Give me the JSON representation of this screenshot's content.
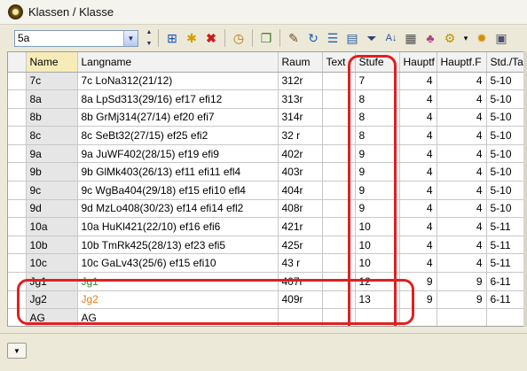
{
  "window": {
    "title": "Klassen / Klasse"
  },
  "toolbar": {
    "combo_value": "5a",
    "icons": [
      "grid-add-icon",
      "new-record-icon",
      "delete-icon",
      "clock-icon",
      "copy-icon",
      "tools-icon",
      "refresh-icon",
      "list-icon",
      "report-icon",
      "filter-icon",
      "sort-icon",
      "fields-icon",
      "users-icon",
      "settings-icon",
      "gear-icon",
      "save-icon"
    ]
  },
  "table": {
    "columns": [
      "Name",
      "Langname",
      "Raum",
      "Text",
      "Stufe",
      "Hauptf",
      "Hauptf.F",
      "Std./Ta"
    ],
    "rows": [
      {
        "name": "7c",
        "langname": "7c LoNa312(21/12)",
        "raum": "312r",
        "text": "",
        "stufe": "7",
        "hauptf": "4",
        "hauptf_f": "4",
        "std": "5-10"
      },
      {
        "name": "8a",
        "langname": "8a LpSd313(29/16) ef17 efi12",
        "raum": "313r",
        "text": "",
        "stufe": "8",
        "hauptf": "4",
        "hauptf_f": "4",
        "std": "5-10"
      },
      {
        "name": "8b",
        "langname": "8b GrMj314(27/14) ef20 efi7",
        "raum": "314r",
        "text": "",
        "stufe": "8",
        "hauptf": "4",
        "hauptf_f": "4",
        "std": "5-10"
      },
      {
        "name": "8c",
        "langname": "8c SeBt32(27/15) ef25 efi2",
        "raum": "32 r",
        "text": "",
        "stufe": "8",
        "hauptf": "4",
        "hauptf_f": "4",
        "std": "5-10"
      },
      {
        "name": "9a",
        "langname": "9a JuWF402(28/15) ef19 efi9",
        "raum": "402r",
        "text": "",
        "stufe": "9",
        "hauptf": "4",
        "hauptf_f": "4",
        "std": "5-10"
      },
      {
        "name": "9b",
        "langname": "9b GlMk403(26/13) ef11 efi11 efl4",
        "raum": "403r",
        "text": "",
        "stufe": "9",
        "hauptf": "4",
        "hauptf_f": "4",
        "std": "5-10"
      },
      {
        "name": "9c",
        "langname": "9c WgBa404(29/18) ef15 efi10 efl4",
        "raum": "404r",
        "text": "",
        "stufe": "9",
        "hauptf": "4",
        "hauptf_f": "4",
        "std": "5-10"
      },
      {
        "name": "9d",
        "langname": "9d MzLo408(30/23) ef14 efi14 efl2",
        "raum": "408r",
        "text": "",
        "stufe": "9",
        "hauptf": "4",
        "hauptf_f": "4",
        "std": "5-10"
      },
      {
        "name": "10a",
        "langname": "10a HuKl421(22/10) ef16 efi6",
        "raum": "421r",
        "text": "",
        "stufe": "10",
        "hauptf": "4",
        "hauptf_f": "4",
        "std": "5-11"
      },
      {
        "name": "10b",
        "langname": "10b TmRk425(28/13) ef23 efi5",
        "raum": "425r",
        "text": "",
        "stufe": "10",
        "hauptf": "4",
        "hauptf_f": "4",
        "std": "5-11"
      },
      {
        "name": "10c",
        "langname": "10c GaLv43(25/6) ef15 efi10",
        "raum": "43 r",
        "text": "",
        "stufe": "10",
        "hauptf": "4",
        "hauptf_f": "4",
        "std": "5-11"
      },
      {
        "name": "Jg1",
        "langname": "Jg1",
        "raum": "407r",
        "text": "",
        "stufe": "12",
        "hauptf": "9",
        "hauptf_f": "9",
        "std": "6-11",
        "color": "green"
      },
      {
        "name": "Jg2",
        "langname": "Jg2",
        "raum": "409r",
        "text": "",
        "stufe": "13",
        "hauptf": "9",
        "hauptf_f": "9",
        "std": "6-11",
        "color": "orange"
      },
      {
        "name": "AG",
        "langname": "AG",
        "raum": "",
        "text": "",
        "stufe": "",
        "hauptf": "",
        "hauptf_f": "",
        "std": ""
      }
    ]
  },
  "colors": {
    "highlight": "#e02020",
    "name_header": "#f7ecb8",
    "green_text": "#2a8a2a",
    "orange_text": "#e0801a"
  }
}
